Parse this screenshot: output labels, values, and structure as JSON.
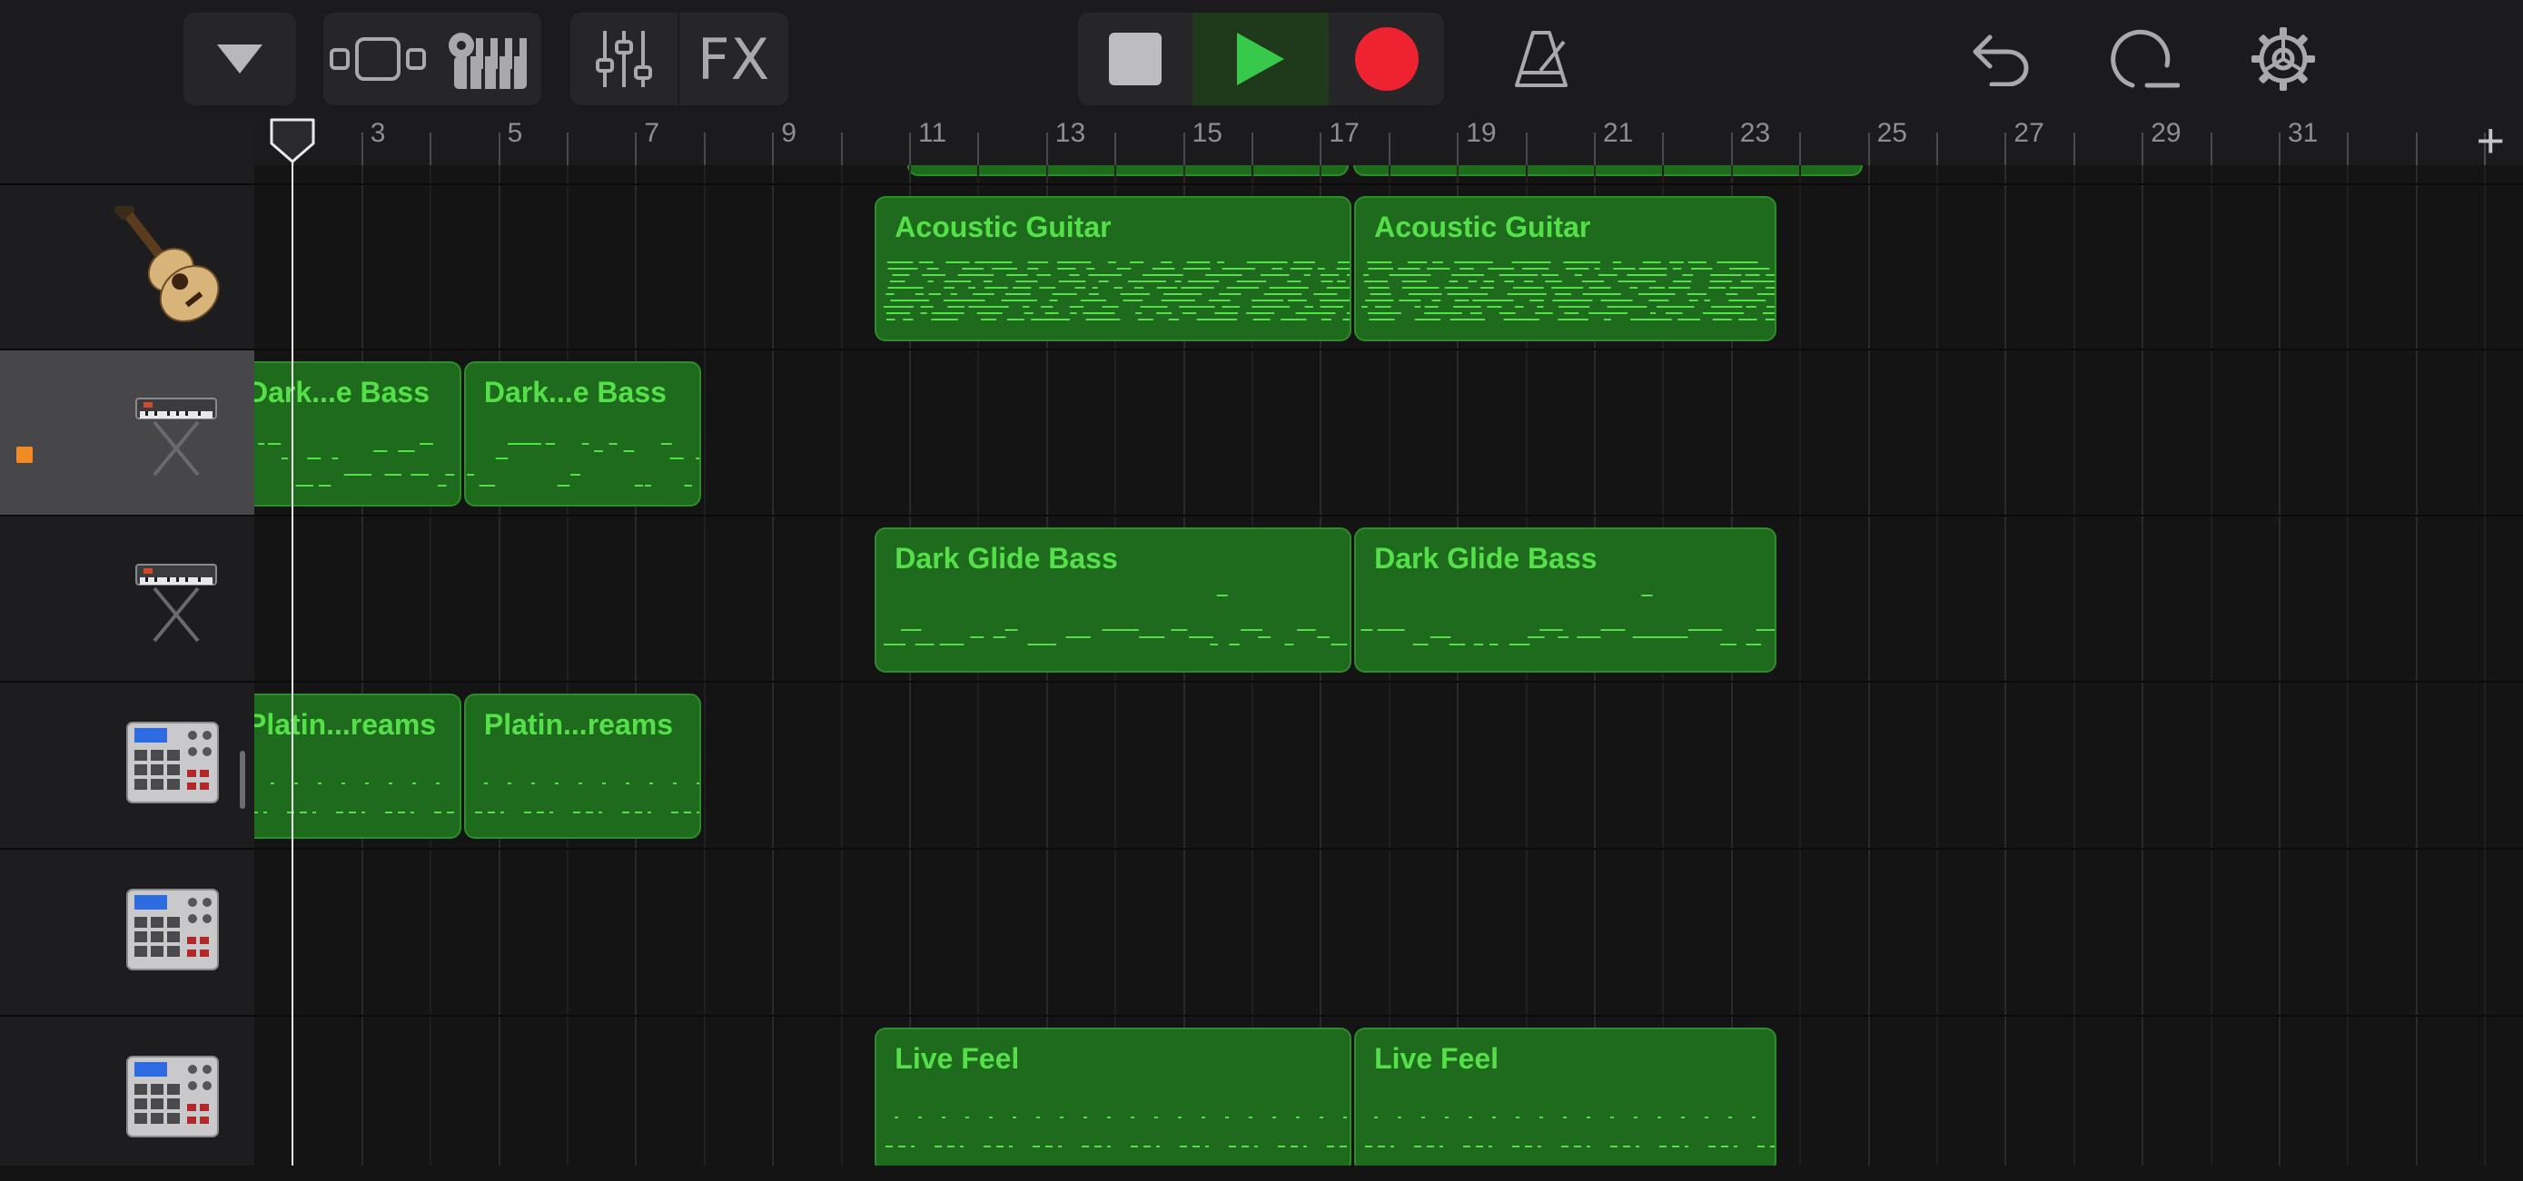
{
  "toolbar": {
    "browser_icon": "triangle-down-icon",
    "tracks_view_icon": "tracks-view-icon",
    "instrument_icon": "keyboard-icon",
    "mixer_icon": "mixer-sliders-icon",
    "fx_label": "FX",
    "stop_icon": "stop-icon",
    "play_icon": "play-icon",
    "record_icon": "record-icon",
    "metronome_icon": "metronome-icon",
    "undo_icon": "undo-icon",
    "loop_icon": "loop-icon",
    "settings_icon": "gear-icon",
    "colors": {
      "play": "#38c84a",
      "record": "#ee2230",
      "accent_green": "#55e04a"
    }
  },
  "ruler": {
    "bars": [
      "3",
      "5",
      "7",
      "9",
      "11",
      "13",
      "15",
      "17",
      "19",
      "21",
      "23",
      "25",
      "27",
      "29",
      "31"
    ],
    "add_label": "+"
  },
  "tracks": [
    {
      "instrument_icon": "acoustic-guitar-icon",
      "regions": [
        {
          "title": "Acoustic Guitar"
        },
        {
          "title": "Acoustic Guitar"
        }
      ]
    },
    {
      "instrument_icon": "synth-keyboard-icon",
      "selected": true,
      "regions": [
        {
          "title": "Dark...e Bass"
        },
        {
          "title": "Dark...e Bass"
        }
      ]
    },
    {
      "instrument_icon": "synth-keyboard-icon",
      "regions": [
        {
          "title": "Dark Glide Bass"
        },
        {
          "title": "Dark Glide Bass"
        }
      ]
    },
    {
      "instrument_icon": "drum-machine-icon",
      "regions": [
        {
          "title": "Platin...reams"
        },
        {
          "title": "Platin...reams"
        }
      ]
    },
    {
      "instrument_icon": "drum-machine-icon",
      "regions": []
    },
    {
      "instrument_icon": "drum-machine-icon",
      "regions": [
        {
          "title": "Live Feel"
        },
        {
          "title": "Live Feel"
        }
      ]
    }
  ]
}
